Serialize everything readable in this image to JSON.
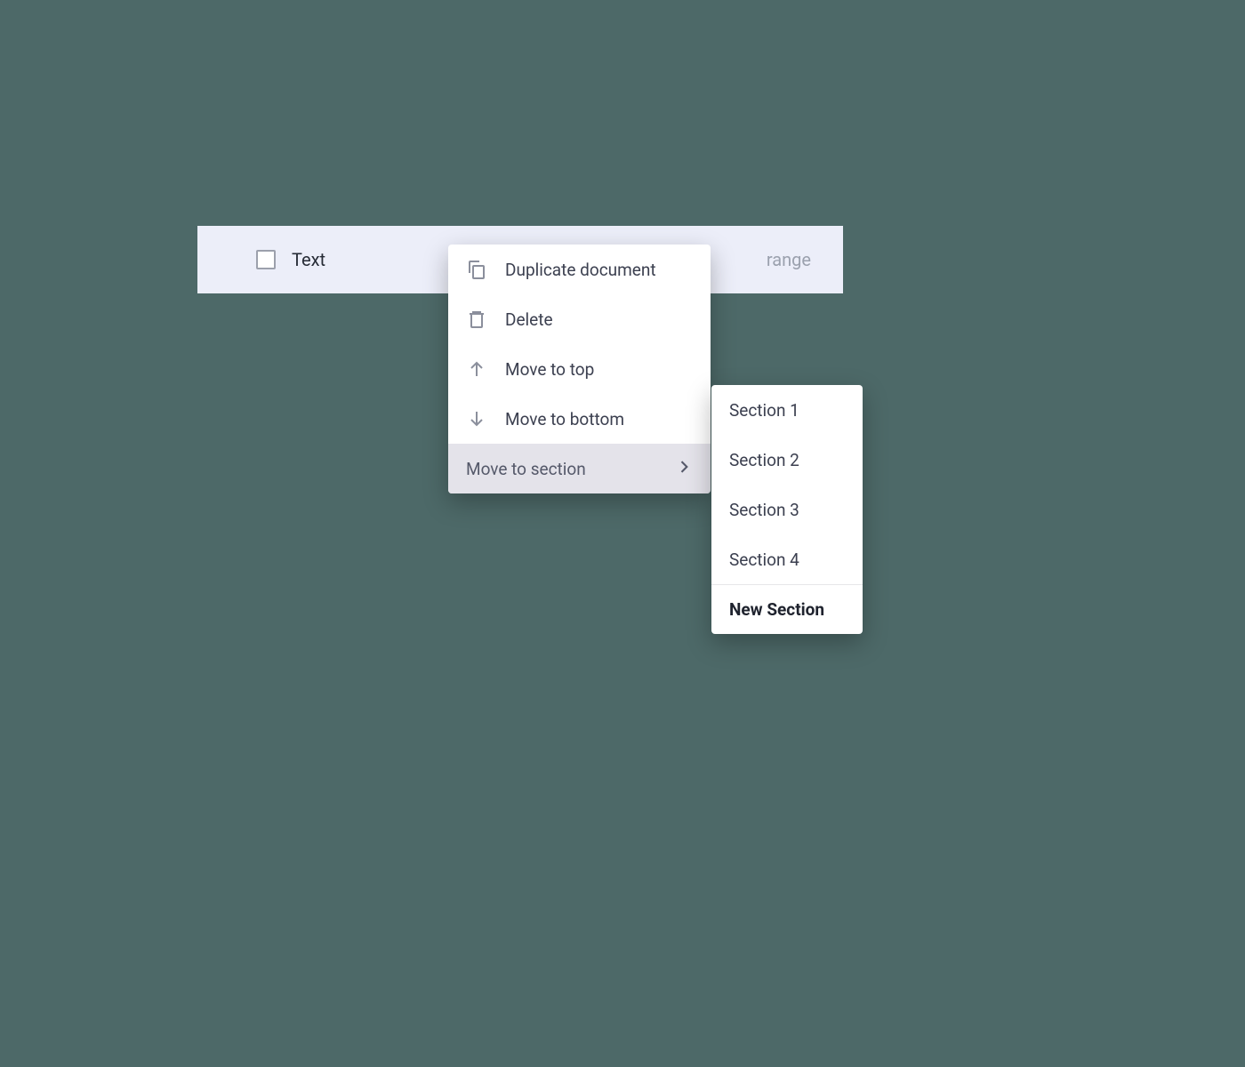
{
  "row": {
    "label": "Text",
    "trailing": "range"
  },
  "contextMenu": {
    "items": [
      {
        "label": "Duplicate document",
        "icon": "copy"
      },
      {
        "label": "Delete",
        "icon": "trash"
      },
      {
        "label": "Move to top",
        "icon": "arrow-up"
      },
      {
        "label": "Move to bottom",
        "icon": "arrow-down"
      },
      {
        "label": "Move to section",
        "icon": null,
        "hasSubmenu": true,
        "highlighted": true
      }
    ]
  },
  "submenu": {
    "items": [
      {
        "label": "Section 1"
      },
      {
        "label": "Section 2"
      },
      {
        "label": "Section 3"
      },
      {
        "label": "Section 4"
      }
    ],
    "newSection": "New Section"
  }
}
